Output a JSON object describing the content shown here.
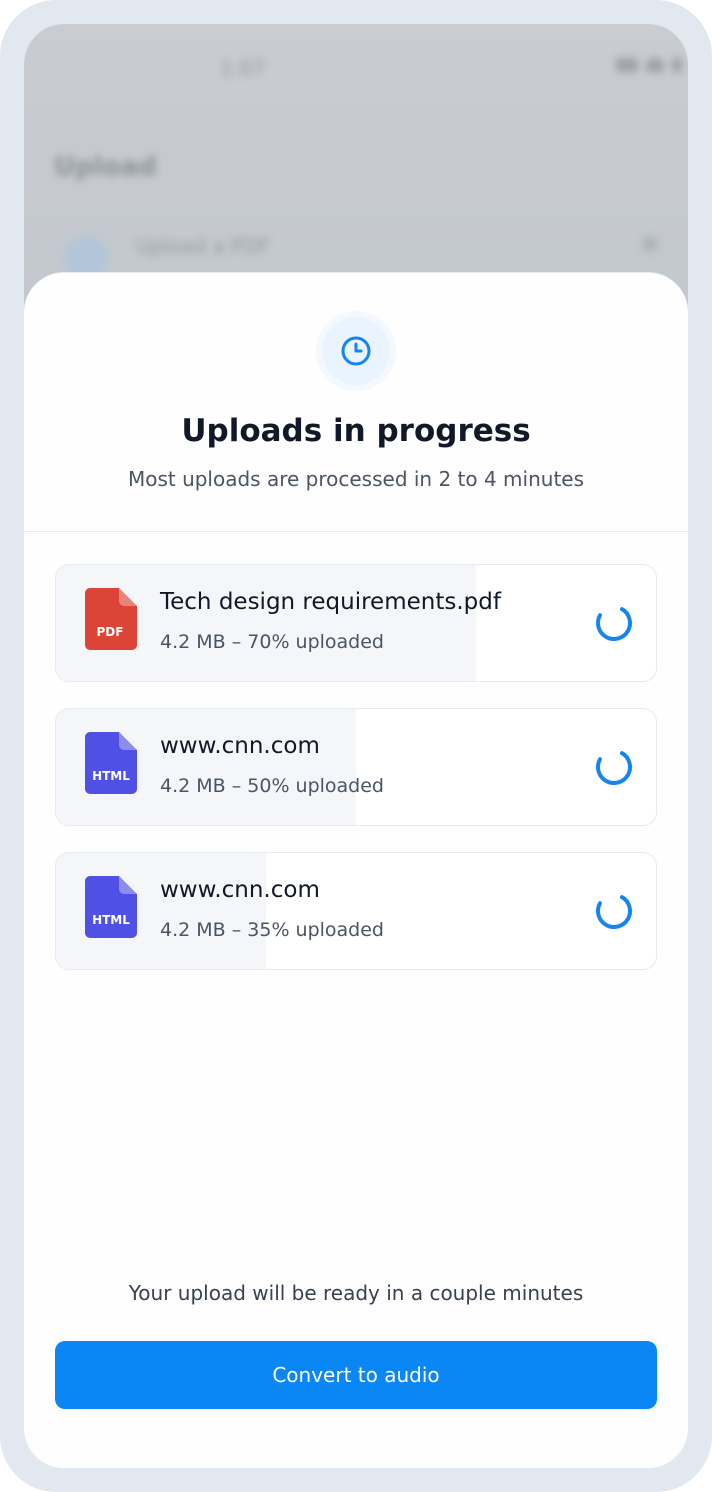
{
  "background_app": {
    "status_time": "1:07",
    "title": "Upload",
    "row_label": "Upload a PDF"
  },
  "sheet": {
    "icon": "clock-icon",
    "title": "Uploads in progress",
    "subtitle": "Most uploads are processed in 2 to 4 minutes"
  },
  "uploads": [
    {
      "type_label": "PDF",
      "icon": "pdf-file-icon",
      "icon_color": "#db4437",
      "name": "Tech design requirements.pdf",
      "meta": "4.2 MB – 70% uploaded",
      "progress": 0.7
    },
    {
      "type_label": "HTML",
      "icon": "html-file-icon",
      "icon_color": "#4f50e6",
      "name": "www.cnn.com",
      "meta": "4.2 MB – 50% uploaded",
      "progress": 0.5
    },
    {
      "type_label": "HTML",
      "icon": "html-file-icon",
      "icon_color": "#4f50e6",
      "name": "www.cnn.com",
      "meta": "4.2 MB – 35% uploaded",
      "progress": 0.35
    }
  ],
  "footer": {
    "ready_text": "Your upload will be ready in a couple minutes",
    "convert_label": "Convert to audio"
  },
  "colors": {
    "accent": "#0a86f5",
    "spinner": "#1586ee"
  }
}
